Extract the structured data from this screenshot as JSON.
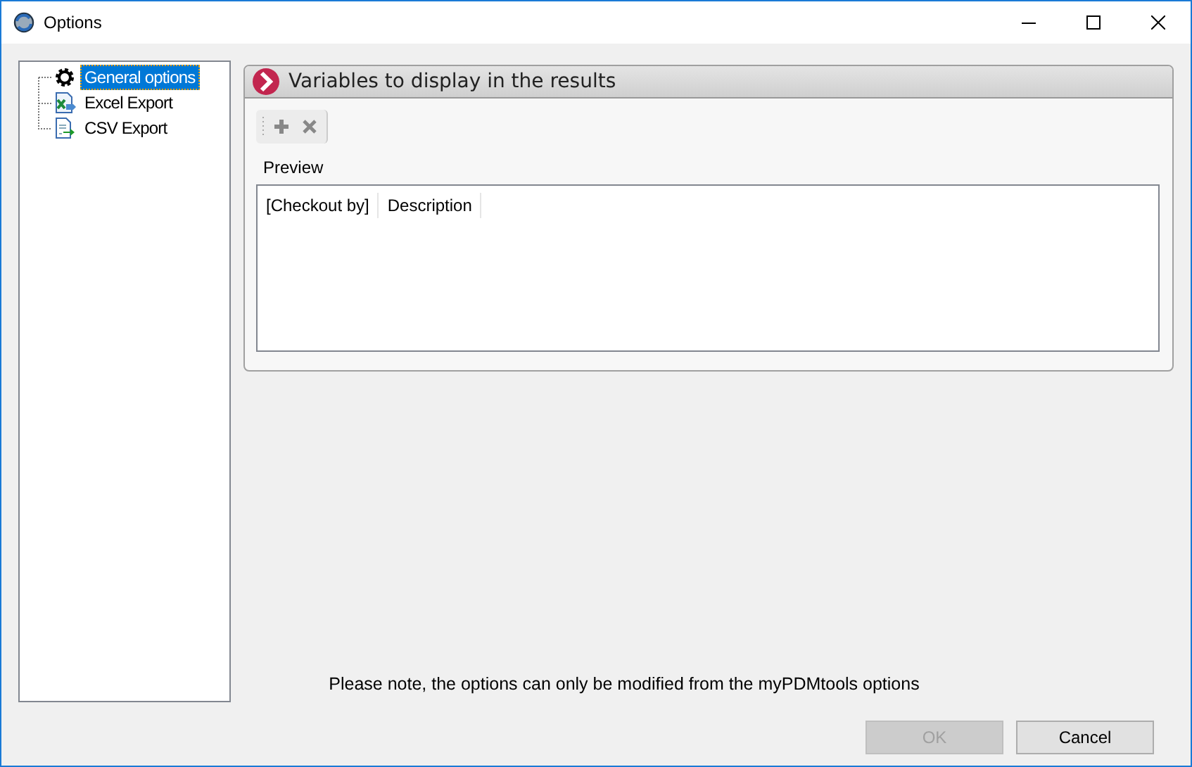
{
  "window": {
    "title": "Options"
  },
  "tree": [
    {
      "label": "General options",
      "kind": "gear",
      "selected": true
    },
    {
      "label": "Excel Export",
      "kind": "excel",
      "selected": false
    },
    {
      "label": "CSV Export",
      "kind": "csv",
      "selected": false
    }
  ],
  "panel": {
    "title": "Variables to display in the results",
    "toolbar": [
      {
        "kind": "add",
        "disabled": true
      },
      {
        "kind": "remove",
        "disabled": true
      }
    ],
    "preview_label": "Preview",
    "preview_columns": [
      "[Checkout by]",
      "Description"
    ]
  },
  "note": "Please note, the options can only be modified from the myPDMtools options",
  "buttons": [
    {
      "label": "OK",
      "disabled": true
    },
    {
      "label": "Cancel",
      "disabled": false
    }
  ]
}
